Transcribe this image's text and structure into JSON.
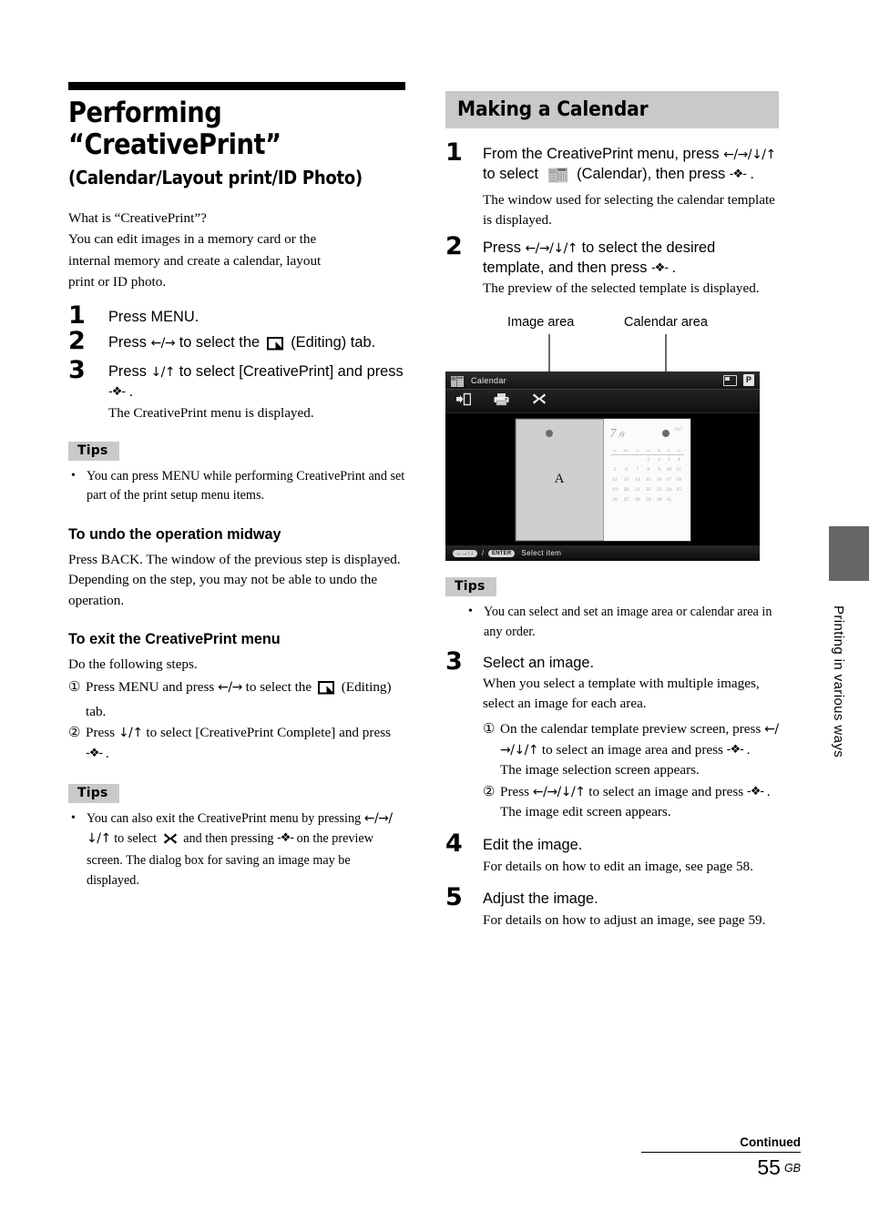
{
  "left": {
    "title_line1": "Performing",
    "title_line2": "“CreativePrint”",
    "subtitle": "(Calendar/Layout print/ID Photo)",
    "intro": [
      "What is “CreativePrint”?",
      "You can edit images in a memory card or the",
      "internal memory and create a calendar, layout",
      "print or ID photo."
    ],
    "steps": [
      {
        "num": "1",
        "head": "Press MENU.",
        "sub": ""
      },
      {
        "num": "2",
        "head_before": "Press ",
        "arrows": "←/→",
        "head_mid": " to select the ",
        "icon": "editing-tab-icon",
        "head_after": " (Editing) tab.",
        "sub": ""
      },
      {
        "num": "3",
        "head_before": "Press ",
        "arrows": "↓/↑",
        "head_mid": " to select [CreativePrint] and press ",
        "dpad": "-❖-",
        "head_after": " .",
        "sub": "The CreativePrint menu is displayed."
      }
    ],
    "tips1_label": "Tips",
    "tips1_items": [
      "You can press MENU while performing CreativePrint and set part of the print setup menu items."
    ],
    "undo_head": "To undo the operation midway",
    "undo_body": "Press BACK. The window of the previous step is displayed. Depending on the step, you may not be able to undo the operation.",
    "exit_head": "To exit the CreativePrint menu",
    "exit_intro": "Do the following steps.",
    "exit_items": [
      {
        "marker": "①",
        "before": "Press MENU and press ",
        "arrows": "←/→",
        "mid": " to select the ",
        "icon": "editing-tab-icon",
        "after": " (Editing) tab."
      },
      {
        "marker": "②",
        "before": "Press ",
        "arrows": "↓/↑",
        "mid": " to select [CreativePrint Complete] and press ",
        "dpad": "-❖-",
        "after": " ."
      }
    ],
    "tips2_label": "Tips",
    "tips2_text": {
      "part1": "You can also exit the CreativePrint menu by pressing ",
      "arrows": "←/→/↓/↑",
      "part2": " to select ",
      "icon": "close-x-icon",
      "part3": " and then pressing ",
      "dpad": "-❖-",
      "part4": " on the preview screen. The dialog box for saving an image may be displayed."
    }
  },
  "right": {
    "section_title": "Making a Calendar",
    "steps": [
      {
        "num": "1",
        "before": "From the CreativePrint menu, press ",
        "arrows": "←/→/↓/↑",
        "mid": " to select ",
        "icon": "calendar-icon",
        "mid2": " (Calendar), then press ",
        "dpad": "-❖-",
        "after": " .",
        "sub": "The window used for selecting the calendar template is displayed."
      },
      {
        "num": "2",
        "before": "Press ",
        "arrows": "←/→/↓/↑",
        "mid": " to select the desired template, and then press ",
        "dpad": "-❖-",
        "after": " .",
        "sub": "The preview of the selected template is displayed."
      }
    ],
    "figure": {
      "callout_image": "Image area",
      "callout_calendar": "Calendar area",
      "device": {
        "title": "Calendar",
        "title_icons": [
          "memory-card-icon",
          "print-p-icon"
        ],
        "toolbar_icons": [
          "enter-icon",
          "print-icon",
          "close-icon"
        ],
        "image_area_letter": "A",
        "calendar": {
          "month": "7",
          "month_suffix": "月",
          "year": "2007",
          "weekdays": [
            "su",
            "mo",
            "tu",
            "we",
            "th",
            "fr",
            "sa"
          ],
          "weeks": [
            [
              "",
              "",
              "",
              "",
              "1",
              "2",
              "3",
              "4"
            ],
            [
              "5",
              "6",
              "7",
              "8",
              "9",
              "10",
              "11"
            ],
            [
              "12",
              "13",
              "14",
              "15",
              "16",
              "17",
              "18"
            ],
            [
              "19",
              "20",
              "21",
              "22",
              "23",
              "24",
              "25"
            ],
            [
              "26",
              "27",
              "28",
              "29",
              "30",
              "31",
              ""
            ]
          ]
        },
        "status_dpad": "←→↑↓",
        "status_slash": "/",
        "status_enter": "ENTER",
        "status_text": "Select item"
      }
    },
    "tips_label": "Tips",
    "tips_items": [
      "You can select and set an image area or calendar area in any order."
    ],
    "steps2": [
      {
        "num": "3",
        "head": "Select an image.",
        "sub": "When you select a template with multiple images, select an image for each area.",
        "subitems": [
          {
            "marker": "①",
            "before": "On the calendar template preview screen, press ",
            "arrows": "←/→/↓/↑",
            "mid": " to select an image area and press ",
            "dpad": "-❖-",
            "after": " .",
            "note": "The image selection screen appears."
          },
          {
            "marker": "②",
            "before": "Press ",
            "arrows": "←/→/↓/↑",
            "mid": " to select an image and press ",
            "dpad": "-❖-",
            "after": " .",
            "note": "The image edit screen appears."
          }
        ]
      },
      {
        "num": "4",
        "head": "Edit the image.",
        "sub": "For details on how to edit an image, see page 58."
      },
      {
        "num": "5",
        "head": "Adjust the image.",
        "sub": "For details on how to adjust an image, see page 59."
      }
    ]
  },
  "side_tab": {
    "label": "Printing in various ways",
    "color": "#666666"
  },
  "footer": {
    "continued": "Continued",
    "page_number": "55",
    "region": "GB"
  }
}
